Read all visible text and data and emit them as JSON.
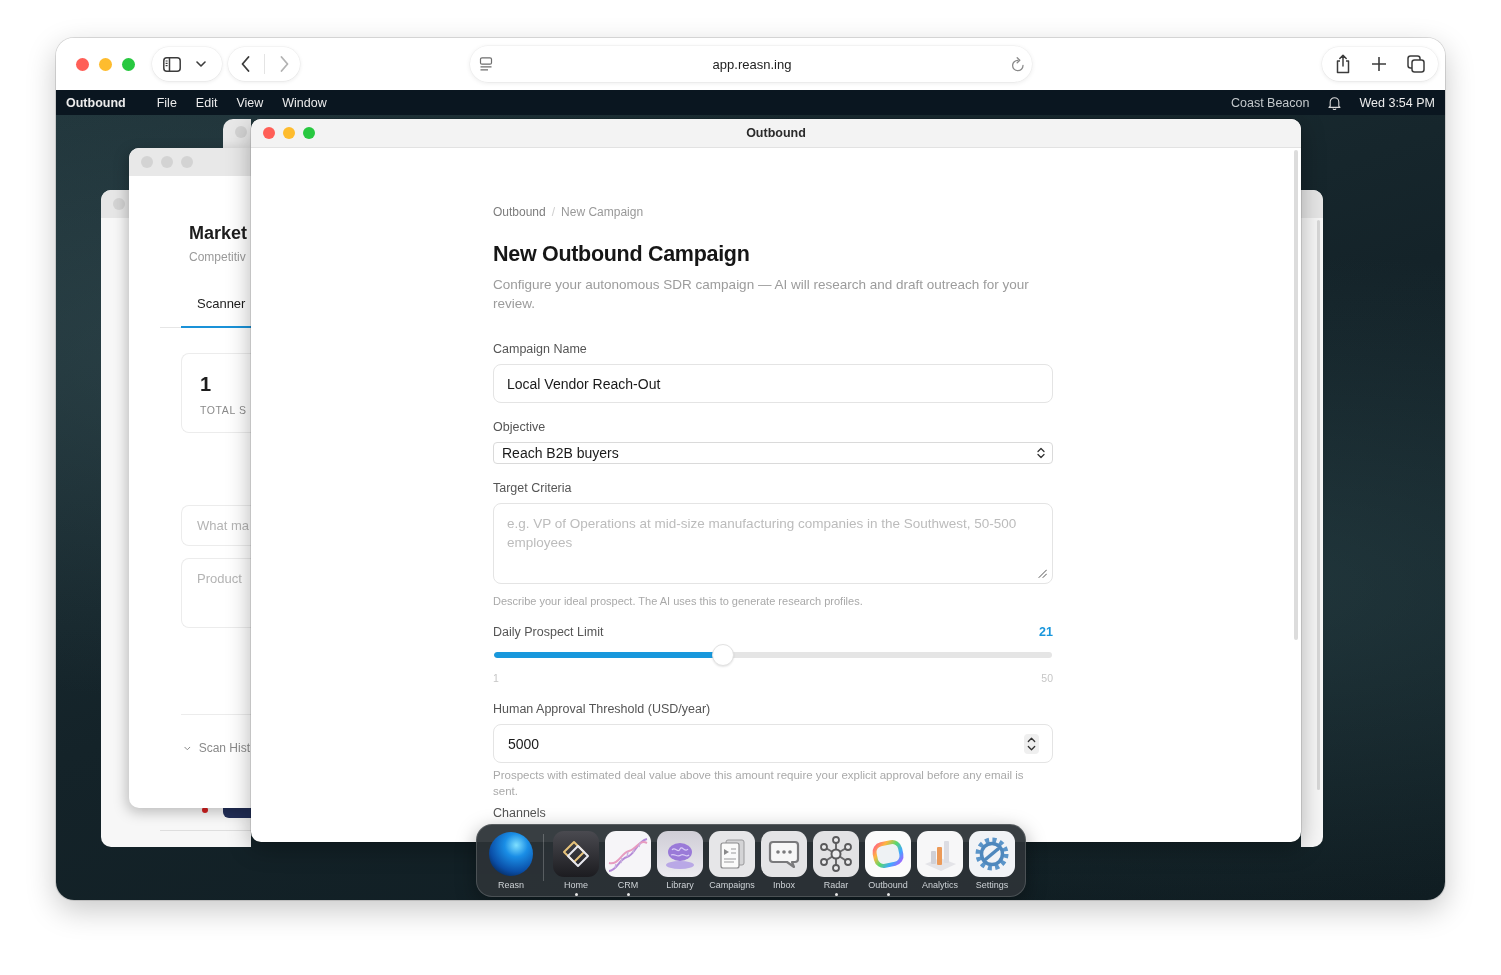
{
  "browser": {
    "url": "app.reasn.ing"
  },
  "menu_bar": {
    "app_name": "Outbound",
    "menus": [
      "File",
      "Edit",
      "View",
      "Window"
    ],
    "account": "Coast Beacon",
    "clock": "Wed 3:54 PM"
  },
  "background_window": {
    "title": "Market",
    "subtitle": "Competitiv",
    "tabs": [
      {
        "label": "Scanner",
        "selected": true
      }
    ],
    "stat": {
      "value": "1",
      "label": "TOTAL S"
    },
    "query_placeholder": "What ma",
    "products_placeholder": "Product",
    "history_label": "Scan Hist"
  },
  "window": {
    "title": "Outbound"
  },
  "form": {
    "breadcrumb": [
      {
        "label": "Outbound"
      },
      {
        "label": "New Campaign"
      }
    ],
    "breadcrumb_separator": "/",
    "title": "New Outbound Campaign",
    "description": "Configure your autonomous SDR campaign — AI will research and draft outreach for your review.",
    "fields": [
      {
        "kind": "text",
        "label": "Campaign Name",
        "value": "Local Vendor Reach-Out"
      },
      {
        "kind": "select",
        "label": "Objective",
        "value": "Reach B2B buyers"
      },
      {
        "kind": "textarea",
        "label": "Target Criteria",
        "placeholder": "e.g. VP of Operations at mid-size manufacturing companies in the Southwest, 50-500 employees",
        "help": "Describe your ideal prospect. The AI uses this to generate research profiles."
      },
      {
        "kind": "slider",
        "label": "Daily Prospect Limit",
        "reading": "21",
        "level": 0.41,
        "min_label": "1",
        "max_label": "50"
      },
      {
        "kind": "number",
        "label": "Human Approval Threshold (USD/year)",
        "value": "5000",
        "help": "Prospects with estimated deal value above this amount require your explicit approval before any email is sent."
      },
      {
        "kind": "heading",
        "label": "Channels"
      }
    ]
  },
  "dock": {
    "items": [
      {
        "label": "Reasn",
        "running": false
      },
      {
        "label": "Home",
        "running": true
      },
      {
        "label": "CRM",
        "running": true
      },
      {
        "label": "Library",
        "running": false
      },
      {
        "label": "Campaigns",
        "running": false
      },
      {
        "label": "Inbox",
        "running": false
      },
      {
        "label": "Radar",
        "running": true
      },
      {
        "label": "Outbound",
        "running": true
      },
      {
        "label": "Analytics",
        "running": false
      },
      {
        "label": "Settings",
        "running": false
      }
    ]
  }
}
